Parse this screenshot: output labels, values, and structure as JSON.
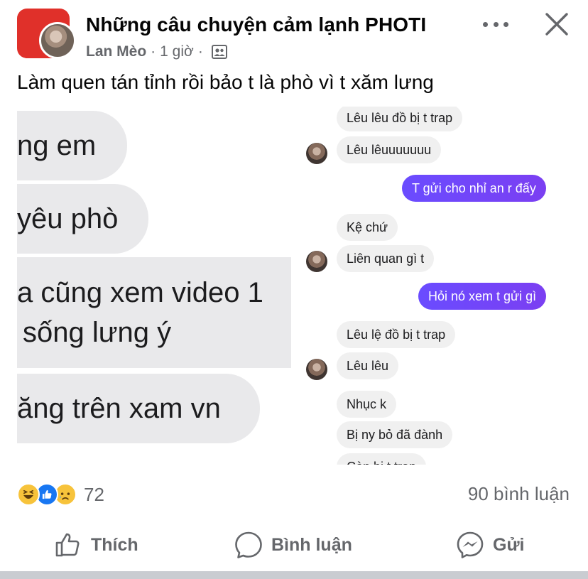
{
  "header": {
    "group_name": "Những câu chuyện cảm lạnh PHOTI",
    "author": "Lan Mèo",
    "time": "1 giờ",
    "separator": "·",
    "audience_icon": "group-audience-icon"
  },
  "caption": "Làm quen tán tỉnh rồi bảo t là phò vì t xăm lưng",
  "image": {
    "left_bubbles": [
      "ng em",
      "yêu phò",
      "a cũng xem video 1",
      "sống lưng ý",
      "ăng trên xam vn"
    ],
    "chat": [
      {
        "text": "Lêu lêu đồ bị t trap",
        "dir": "in"
      },
      {
        "text": "Lêu lêuuuuuuu",
        "dir": "in"
      },
      {
        "text": "T gửi cho nhỉ an r đấy",
        "dir": "out"
      },
      {
        "text": "Kệ chứ",
        "dir": "in"
      },
      {
        "text": "Liên quan gì t",
        "dir": "in"
      },
      {
        "text": "Hỏi nó xem t gửi gì",
        "dir": "out"
      },
      {
        "text": "Lêu lệ đồ bị t trap",
        "dir": "in"
      },
      {
        "text": "Lêu lêu",
        "dir": "in"
      },
      {
        "text": "Nhục k",
        "dir": "in"
      },
      {
        "text": "Bị ny bỏ đã đành",
        "dir": "in"
      },
      {
        "text": "Còn bị t trap",
        "dir": "in"
      }
    ]
  },
  "reactions": {
    "icons": [
      "haha-reaction-icon",
      "like-reaction-icon",
      "sad-reaction-icon"
    ],
    "count": "72"
  },
  "comments_count": "90 bình luận",
  "actions": {
    "like": "Thích",
    "comment": "Bình luận",
    "send": "Gửi"
  },
  "colors": {
    "outgoing_bubble": "#7b3ff2",
    "like_blue": "#1877f2",
    "secondary_text": "#65676b"
  }
}
